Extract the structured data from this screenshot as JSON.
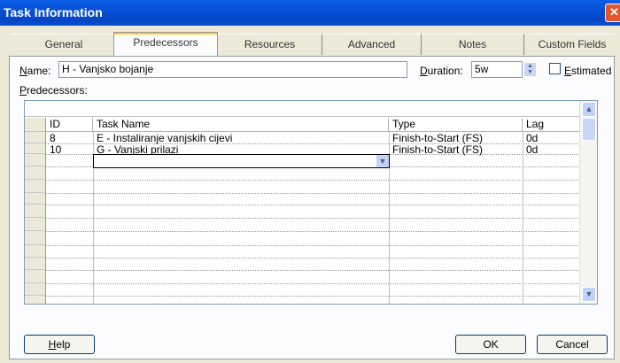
{
  "window": {
    "title": "Task Information",
    "close_glyph": "✕"
  },
  "tabs": [
    {
      "label": "General"
    },
    {
      "label": "Predecessors"
    },
    {
      "label": "Resources"
    },
    {
      "label": "Advanced"
    },
    {
      "label": "Notes"
    },
    {
      "label": "Custom Fields"
    }
  ],
  "form": {
    "name_label_first": "N",
    "name_label_rest": "ame:",
    "name_value": "H - Vanjsko bojanje",
    "duration_label_first": "D",
    "duration_label_rest": "uration:",
    "duration_value": "5w",
    "estimated_label_first": "E",
    "estimated_label_rest": "stimated",
    "estimated_checked": false,
    "predecessors_label_first": "P",
    "predecessors_label_rest": "redecessors:"
  },
  "grid": {
    "columns": [
      "ID",
      "Task Name",
      "Type",
      "Lag"
    ],
    "rows": [
      {
        "id": "8",
        "task_name": "E - Instaliranje vanjskih cijevi",
        "type": "Finish-to-Start (FS)",
        "lag": "0d"
      },
      {
        "id": "10",
        "task_name": "G - Vanjski prilazi",
        "type": "Finish-to-Start (FS)",
        "lag": "0d"
      }
    ]
  },
  "icons": {
    "spin_up": "▲",
    "spin_down": "▼",
    "combo_arrow": "▼",
    "scroll_up": "▲",
    "scroll_down": "▼"
  },
  "buttons": {
    "help_first": "H",
    "help_rest": "elp",
    "ok": "OK",
    "cancel": "Cancel"
  }
}
